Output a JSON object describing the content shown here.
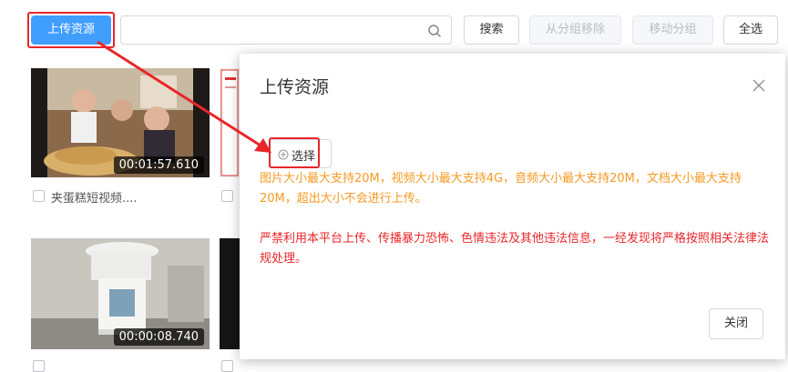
{
  "toolbar": {
    "upload_label": "上传资源",
    "search_placeholder": "",
    "search_label": "搜索",
    "remove_label": "从分组移除",
    "move_label": "移动分组",
    "select_all_label": "全选"
  },
  "items": [
    {
      "duration": "00:01:57.610",
      "label": "夹蛋糕短视频...."
    },
    {
      "duration": "00:00:08.740",
      "label": ""
    }
  ],
  "modal": {
    "title": "上传资源",
    "choose_label": "选择",
    "tip_size": "图片大小最大支持20M，视频大小最大支持4G，音频大小最大支持20M，文档大小最大支持20M，超出大小不会进行上传。",
    "tip_legal": "严禁利用本平台上传、传播暴力恐怖、色情违法及其他违法信息，一经发现将严格按照相关法律法规处理。",
    "close_label": "关闭"
  },
  "colors": {
    "primary": "#409eff",
    "annotation_red": "#e8262a",
    "tip_orange": "#f59a23"
  }
}
